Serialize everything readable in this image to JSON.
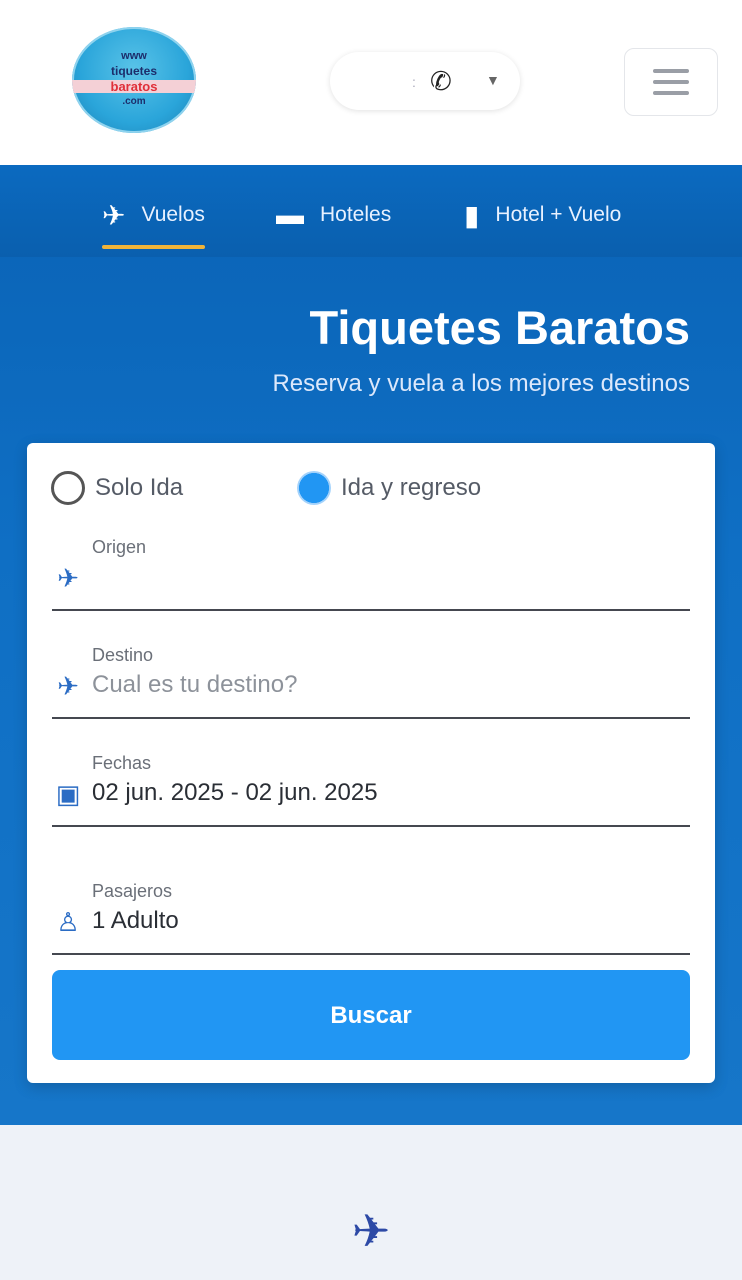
{
  "header": {
    "logo_text": [
      "www",
      "tiquetes",
      "baratos",
      ".com"
    ],
    "phone_icon": "phone-icon",
    "menu_icon": "hamburger-icon"
  },
  "tabs": [
    {
      "label": "Vuelos",
      "icon": "plane-icon",
      "active": true
    },
    {
      "label": "Hoteles",
      "icon": "bed-icon",
      "active": false
    },
    {
      "label": "Hotel + Vuelo",
      "icon": "luggage-icon",
      "active": false
    }
  ],
  "hero": {
    "title": "Tiquetes Baratos",
    "subtitle": "Reserva y vuela a los mejores destinos"
  },
  "form": {
    "trip_type": [
      {
        "label": "Solo Ida",
        "checked": false
      },
      {
        "label": "Ida y regreso",
        "checked": true
      }
    ],
    "origin": {
      "label": "Origen",
      "value": ""
    },
    "destination": {
      "label": "Destino",
      "placeholder": "Cual es tu destino?"
    },
    "dates": {
      "label": "Fechas",
      "value": "02 jun. 2025 - 02 jun. 2025"
    },
    "passengers": {
      "label": "Pasajeros",
      "value": "1 Adulto"
    },
    "search_label": "Buscar"
  },
  "colors": {
    "primary": "#0a63b6",
    "button": "#2196f3",
    "accent": "#f0b43a"
  }
}
